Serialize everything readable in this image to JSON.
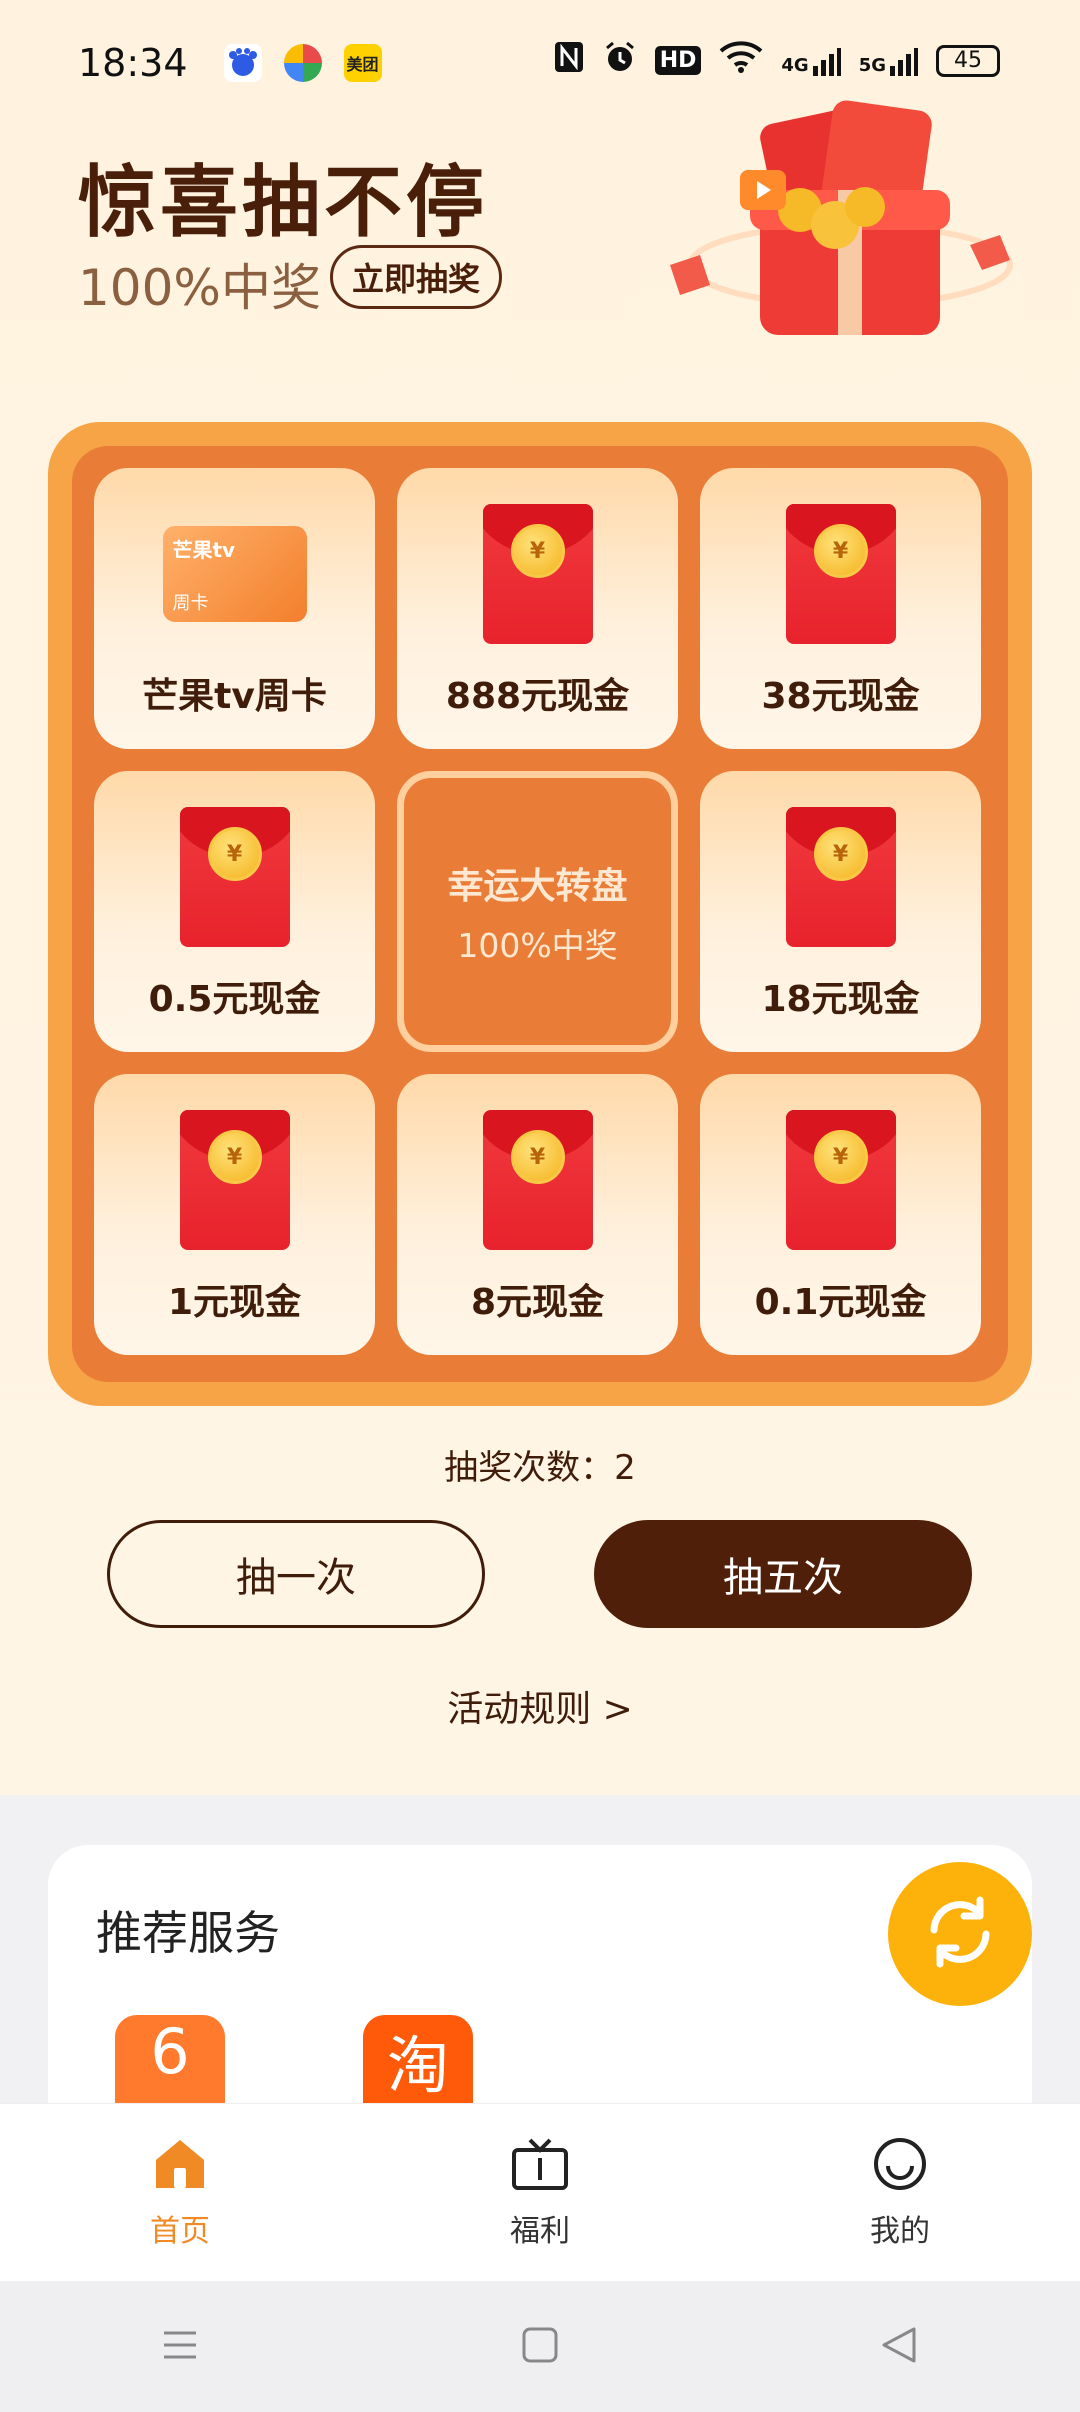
{
  "status": {
    "time": "18:34",
    "app_icons": [
      "baidu",
      "colorful-app",
      "美团"
    ],
    "network": [
      "4G",
      "5G"
    ],
    "battery": "45"
  },
  "header": {
    "title": "惊喜抽不停",
    "subtitle": "100%中奖",
    "draw_now_label": "立即抽奖"
  },
  "board": {
    "cells": [
      {
        "label": "芒果tv周卡",
        "type": "card",
        "card_brand": "芒果tv",
        "card_sub": "周卡"
      },
      {
        "label": "888元现金",
        "type": "envelope"
      },
      {
        "label": "38元现金",
        "type": "envelope"
      },
      {
        "label": "0.5元现金",
        "type": "envelope"
      },
      {
        "label": "center",
        "type": "center",
        "title": "幸运大转盘",
        "sub": "100%中奖"
      },
      {
        "label": "18元现金",
        "type": "envelope"
      },
      {
        "label": "1元现金",
        "type": "envelope"
      },
      {
        "label": "8元现金",
        "type": "envelope"
      },
      {
        "label": "0.1元现金",
        "type": "envelope"
      }
    ],
    "coin_symbol": "¥"
  },
  "draw": {
    "count_text": "抽奖次数：2",
    "once_label": "抽一次",
    "five_label": "抽五次",
    "rules_label": "活动规则 >"
  },
  "recommend": {
    "title": "推荐服务",
    "apps": [
      {
        "glyph": "6"
      },
      {
        "glyph": "淘"
      }
    ]
  },
  "tabbar": {
    "tabs": [
      {
        "label": "首页",
        "icon": "home-icon",
        "active": true
      },
      {
        "label": "福利",
        "icon": "tv-icon",
        "active": false
      },
      {
        "label": "我的",
        "icon": "smile-icon",
        "active": false
      }
    ]
  },
  "colors": {
    "accent": "#f08a24",
    "board_outer": "#f7a447",
    "board_inner": "#e97c37",
    "dark_button": "#4f1f0a"
  }
}
